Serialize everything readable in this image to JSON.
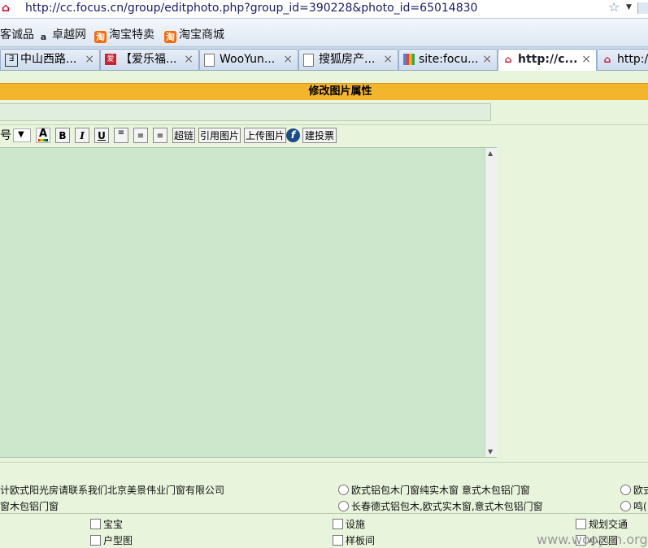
{
  "browser": {
    "url": "http://cc.focus.cn/group/editphoto.php?group_id=390228&photo_id=65014830",
    "bookmarks": [
      "客诚品",
      "卓越网",
      "淘宝特卖",
      "淘宝商城"
    ],
    "tabs": [
      {
        "label": "中山西路...",
        "icon": "page-icon"
      },
      {
        "label": "【爱乐福...",
        "icon": "forum-icon"
      },
      {
        "label": "WooYun...",
        "icon": "doc-icon"
      },
      {
        "label": "搜狐房产...",
        "icon": "doc-icon"
      },
      {
        "label": "site:focu...",
        "icon": "google-icon"
      },
      {
        "label": "http://c...",
        "icon": "focus-icon",
        "active": true
      },
      {
        "label": "http:/",
        "icon": "focus-icon"
      }
    ]
  },
  "page": {
    "title": "修改图片属性",
    "toolbar": {
      "size_label": "号",
      "bold": "B",
      "italic": "I",
      "underline": "U",
      "link": "超链",
      "quote_image": "引用图片",
      "upload_image": "上传图片",
      "vote": "建投票"
    },
    "options_left": [
      "计欧式阳光房请联系我们北京美景伟业门窗有限公司",
      "窗木包铝门窗"
    ],
    "options_mid": [
      "欧式铝包木门窗纯实木窗 意式木包铝门窗",
      "长春德式铝包木,欧式实木窗,意式木包铝门窗"
    ],
    "options_right": [
      "欧式",
      "鸣("
    ],
    "categories": [
      [
        "宝宝",
        "设施",
        "规划交通"
      ],
      [
        "户型图",
        "样板间",
        "小区图"
      ]
    ],
    "watermark": "www.wooyun.org"
  }
}
